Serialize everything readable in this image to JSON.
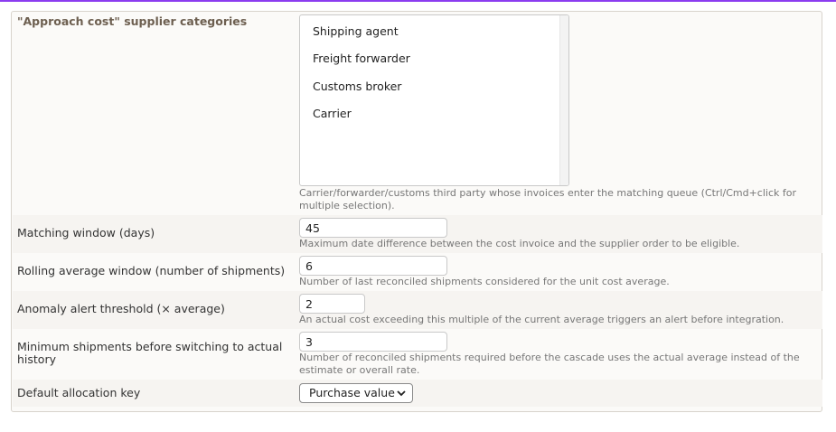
{
  "form": {
    "categories": {
      "label": "\"Approach cost\" supplier categories",
      "options": [
        "Shipping agent",
        "Freight forwarder",
        "Customs broker",
        "Carrier"
      ],
      "hint": "Carrier/forwarder/customs third party whose invoices enter the matching queue (Ctrl/Cmd+click for multiple selection)."
    },
    "matching_window": {
      "label": "Matching window (days)",
      "value": "45",
      "hint": "Maximum date difference between the cost invoice and the supplier order to be eligible."
    },
    "rolling_average": {
      "label": "Rolling average window (number of shipments)",
      "value": "6",
      "hint": "Number of last reconciled shipments considered for the unit cost average."
    },
    "anomaly_threshold": {
      "label": "Anomaly alert threshold (× average)",
      "value": "2",
      "hint": "An actual cost exceeding this multiple of the current average triggers an alert before integration."
    },
    "min_shipments": {
      "label_line1": "Minimum shipments before switching to actual",
      "label_line2": "history",
      "value": "3",
      "hint_line1": "Number of reconciled shipments required before the cascade uses the actual average instead of the",
      "hint_line2": "estimate or overall rate."
    },
    "allocation_key": {
      "label": "Default allocation key",
      "selected": "Purchase value"
    }
  },
  "colors": {
    "accent": "#8b3cf0"
  }
}
